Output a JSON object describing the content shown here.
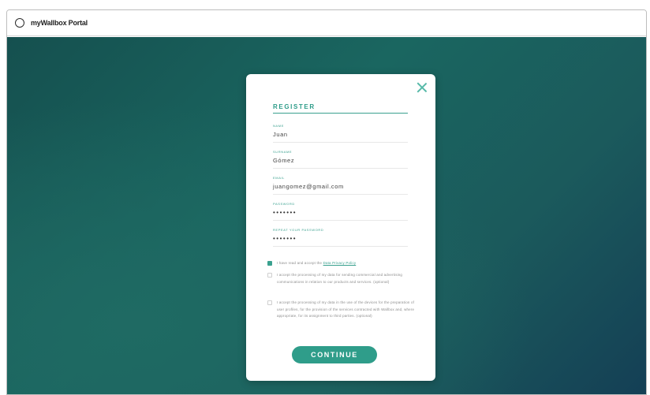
{
  "window": {
    "title": "myWallbox Portal"
  },
  "modal": {
    "title": "REGISTER",
    "fields": [
      {
        "label": "NAME",
        "value": "Juan"
      },
      {
        "label": "SURNAME",
        "value": "Gómez"
      },
      {
        "label": "EMAIL",
        "value": "juangomez@gmail.com"
      },
      {
        "label": "PASSWORD",
        "value": "•••••••"
      },
      {
        "label": "REPEAT YOUR PASSWORD",
        "value": "•••••••"
      }
    ],
    "consents": [
      {
        "text": "I have read and accept the ",
        "link": "Data Privacy Policy",
        "checked": true
      },
      {
        "text": "I accept the processing of my data for sending commercial and advertising communications in relation to our products and services. (optional)",
        "checked": false
      },
      {
        "text": "I accept the processing of my data in the use of the devices for the preparation of user profiles, for the provision of the services contracted with Wallbox and, where appropriate, for its assignment to third parties. (optional)",
        "checked": false
      }
    ],
    "continue_label": "CONTINUE"
  },
  "colors": {
    "accent": "#2f9d8a",
    "background": "#1a5f5e"
  }
}
